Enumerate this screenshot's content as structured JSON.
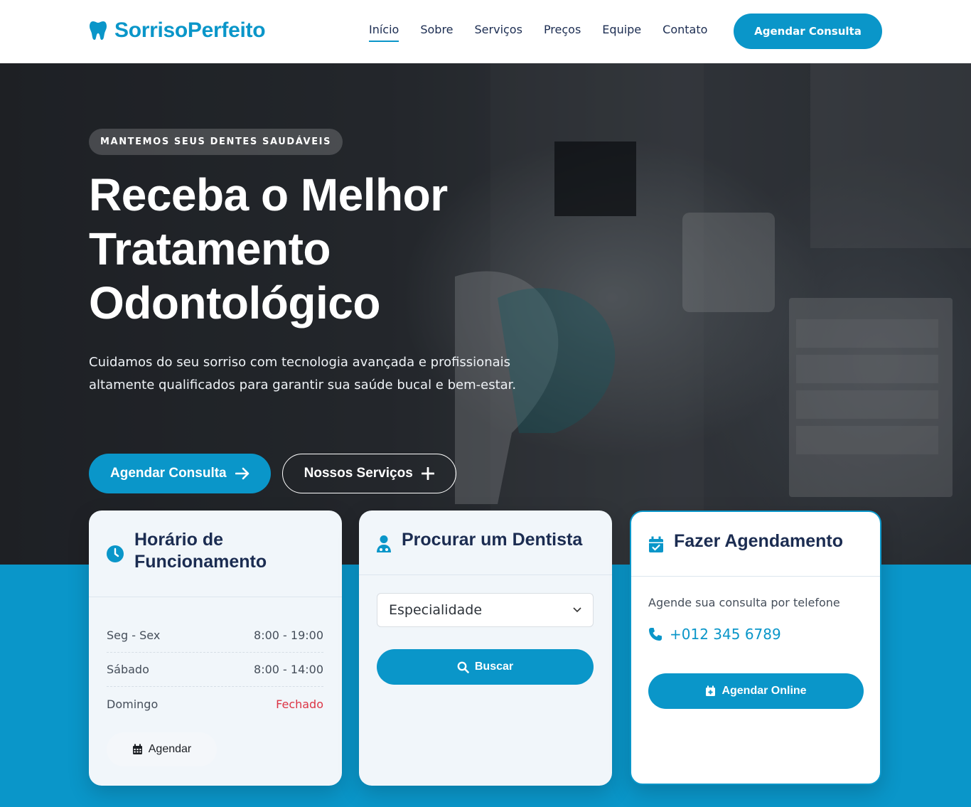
{
  "brand": {
    "name": "SorrisoPerfeito",
    "icon": "tooth-icon",
    "color": "#0a96c9"
  },
  "nav": {
    "links": [
      "Início",
      "Sobre",
      "Serviços",
      "Preços",
      "Equipe",
      "Contato"
    ],
    "active": "Início",
    "cta": "Agendar Consulta"
  },
  "hero": {
    "tag": "MANTEMOS SEUS DENTES SAUDÁVEIS",
    "title_lines": [
      "Receba o Melhor",
      "Tratamento",
      "Odontológico"
    ],
    "text": "Cuidamos do seu sorriso com tecnologia avançada e profissionais altamente qualificados para garantir sua saúde bucal e bem-estar.",
    "primary_button": {
      "label": "Agendar Consulta",
      "icon": "arrow-right-icon"
    },
    "secondary_button": {
      "label": "Nossos Serviços",
      "icon": "plus-icon"
    }
  },
  "cards": {
    "hours": {
      "title_lines": [
        "Horário de",
        "Funcionamento"
      ],
      "icon": "clock-icon",
      "rows": [
        {
          "day": "Seg - Sex",
          "time": "8:00 - 19:00"
        },
        {
          "day": "Sábado",
          "time": "8:00 - 14:00"
        },
        {
          "day": "Domingo",
          "time": "Fechado"
        }
      ],
      "button": {
        "label": "Agendar",
        "icon": "calendar-icon"
      }
    },
    "dentist": {
      "title": "Procurar um Dentista",
      "icon": "doctor-icon",
      "select_value": "Especialidade",
      "button": {
        "label": "Buscar",
        "icon": "search-icon"
      }
    },
    "appointment": {
      "title": "Fazer Agendamento",
      "icon": "calendar-check-icon",
      "text": "Agende sua consulta por telefone",
      "phone": "+012 345 6789",
      "button": {
        "label": "Agendar Online",
        "icon": "calendar-plus-icon"
      }
    }
  },
  "colors": {
    "accent": "#0a96c9",
    "dark": "#1b2c51",
    "closed": "#dc3545"
  }
}
